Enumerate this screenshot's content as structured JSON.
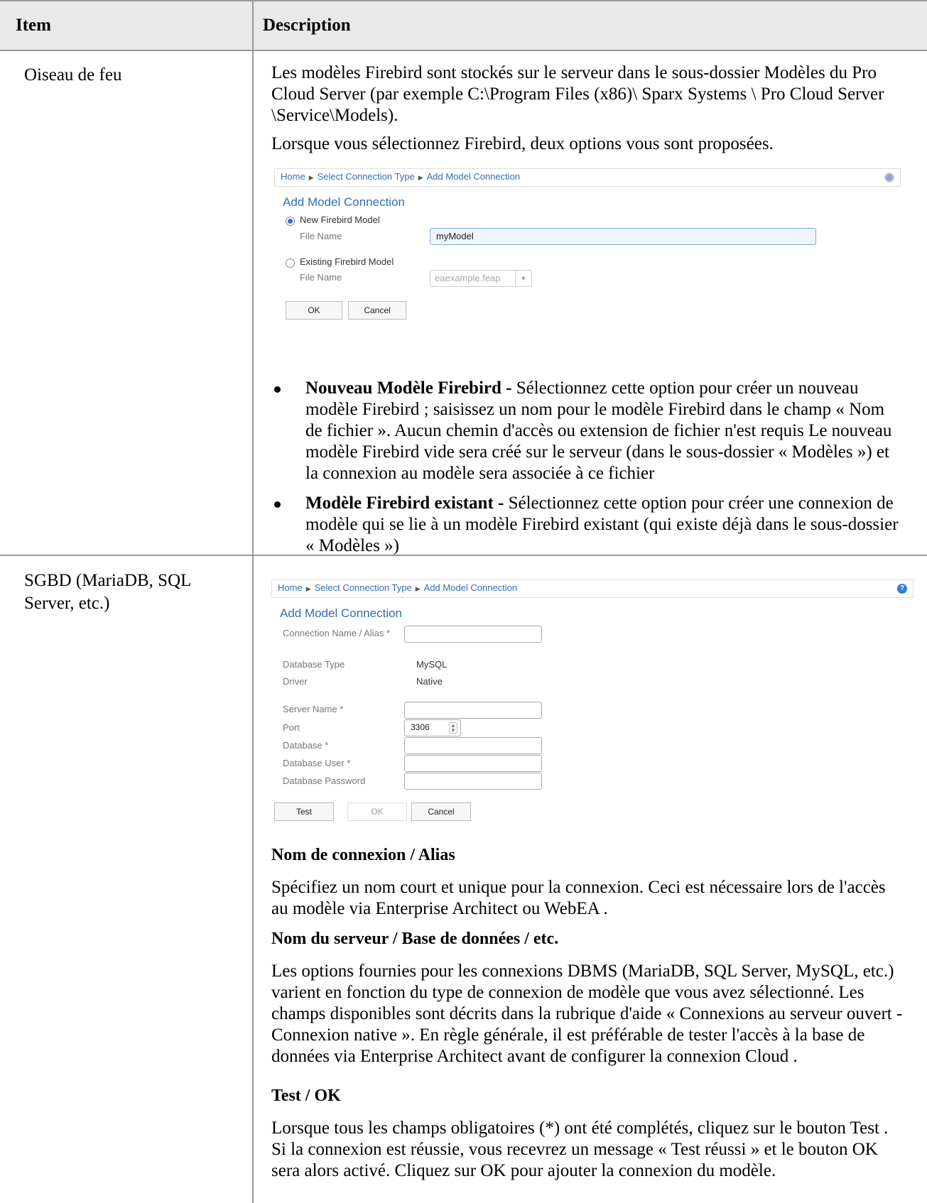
{
  "table": {
    "header": {
      "item": "Item",
      "description": "Description"
    },
    "row1": {
      "item": "Oiseau de feu",
      "para1": "Les modèles Firebird sont stockés sur le serveur dans le sous-dossier Modèles du Pro Cloud Server (par exemple C:\\Program Files (x86)\\ Sparx Systems \\ Pro Cloud Server \\Service\\Models).",
      "para2": "Lorsque vous sélectionnez Firebird, deux options vous sont proposées.",
      "bullets": [
        {
          "bold": "Nouveau Modèle Firebird -",
          "text": " Sélectionnez cette option pour créer un nouveau modèle Firebird ; saisissez un nom pour le modèle Firebird dans le champ « Nom de fichier ». Aucun chemin d'accès ou extension de fichier n'est requis Le nouveau modèle Firebird vide sera créé sur le serveur (dans le sous-dossier « Modèles ») et la connexion au modèle sera associée à ce fichier"
        },
        {
          "bold": "Modèle Firebird existant -",
          "text": " Sélectionnez cette option pour créer une connexion de modèle qui se lie à un modèle Firebird existant (qui existe déjà dans le sous-dossier « Modèles »)"
        }
      ]
    },
    "row2": {
      "item": "SGBD (MariaDB, SQL Server, etc.)",
      "h1": "Nom de connexion / Alias",
      "p1": "Spécifiez un nom court et unique pour la connexion. Ceci est nécessaire lors de l'accès au modèle via Enterprise Architect ou WebEA .",
      "h2": "Nom du serveur / Base de données / etc.",
      "p2": "Les options fournies pour les connexions DBMS (MariaDB, SQL Server, MySQL, etc.) varient en fonction du type de connexion de modèle que vous avez sélectionné. Les champs disponibles sont décrits dans la rubrique d'aide « Connexions au serveur ouvert - Connexion native ». En règle générale, il est préférable de tester l'accès à la base de données via Enterprise Architect avant de configurer la connexion Cloud .",
      "h3": "Test / OK",
      "p3": "Lorsque tous les champs obligatoires (*) ont été complétés, cliquez sur le bouton Test . Si la connexion est réussie, vous recevrez un message « Test réussi » et le bouton OK sera alors activé. Cliquez sur OK pour ajouter la connexion du modèle."
    }
  },
  "shot1": {
    "breadcrumb": [
      "Home",
      "Select Connection Type",
      "Add Model Connection"
    ],
    "title": "Add Model Connection",
    "opt_new": "New Firebird Model",
    "file_name_label": "File Name",
    "file_name_value": "myModel",
    "opt_existing": "Existing Firebird Model",
    "file_name_label2": "File Name",
    "existing_value": "eaexample.feap",
    "ok": "OK",
    "cancel": "Cancel",
    "help_color": "#9aa3c8"
  },
  "shot2": {
    "breadcrumb": [
      "Home",
      "Select Connection Type",
      "Add Model Connection"
    ],
    "title": "Add Model Connection",
    "conn_name": "Connection Name / Alias *",
    "db_type_label": "Database Type",
    "db_type_value": "MySQL",
    "driver_label": "Driver",
    "driver_value": "Native",
    "server_name": "Server Name *",
    "port_label": "Port",
    "port_value": "3306",
    "database": "Database *",
    "db_user": "Database User *",
    "db_password": "Database Password",
    "test": "Test",
    "ok": "OK",
    "cancel": "Cancel",
    "help_color": "#2f7fd8"
  }
}
